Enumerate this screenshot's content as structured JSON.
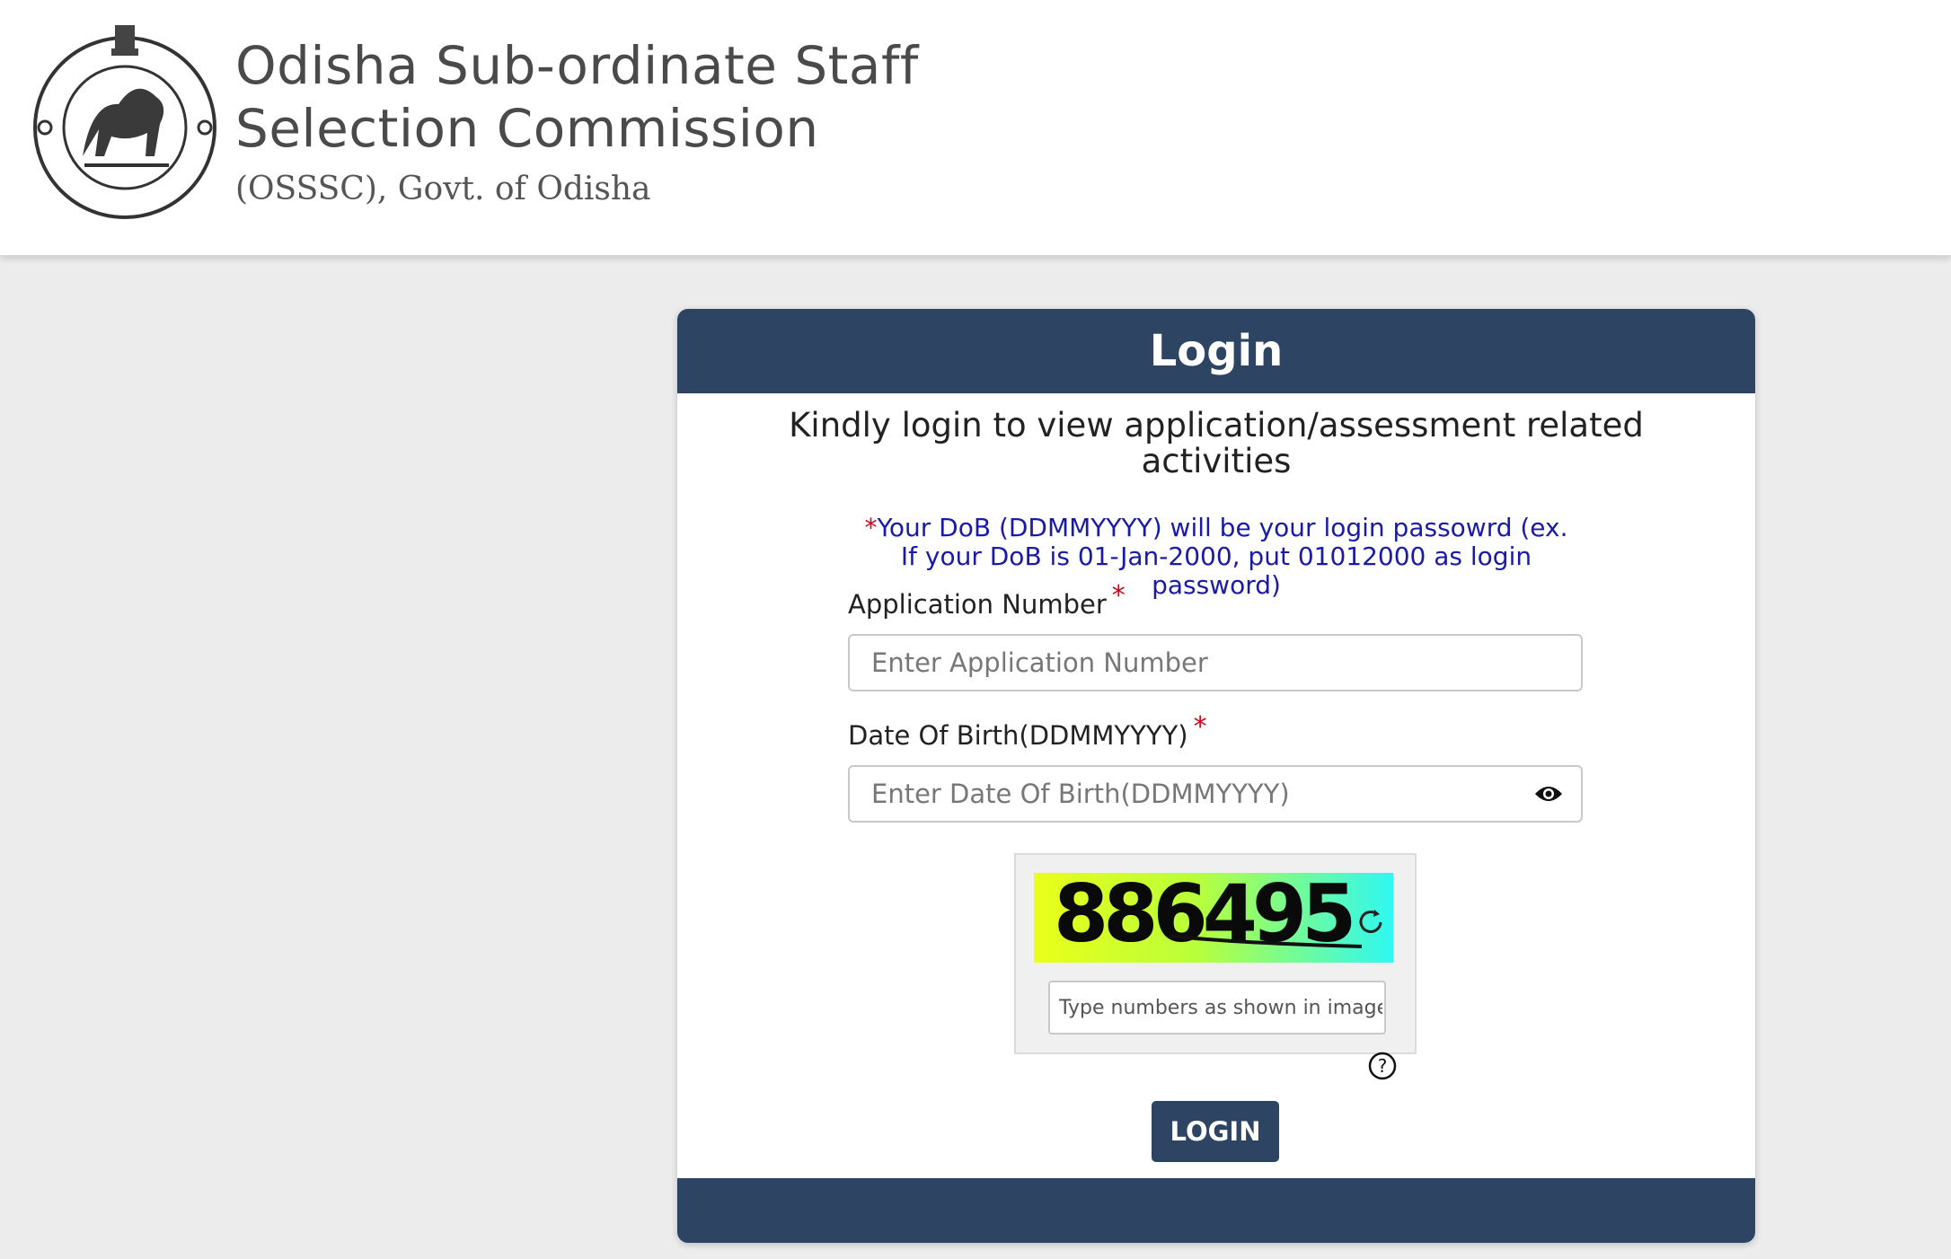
{
  "header": {
    "title_line1": "Odisha Sub-ordinate Staff",
    "title_line2": "Selection Commission",
    "subtitle": "(OSSSC), Govt. of Odisha",
    "emblem_icon": "odisha-state-emblem-icon"
  },
  "login_card": {
    "title": "Login",
    "intro": "Kindly login to view application/assessment related activities",
    "note_star": "*",
    "note": "Your DoB (DDMMYYYY) will be your login passowrd (ex. If your DoB is 01-Jan-2000, put 01012000 as login password)",
    "application_number": {
      "label": "Application Number",
      "required_mark": "*",
      "placeholder": "Enter Application Number",
      "value": ""
    },
    "dob": {
      "label": "Date Of Birth(DDMMYYYY)",
      "required_mark": "*",
      "placeholder": "Enter Date Of Birth(DDMMYYYY)",
      "value": "",
      "toggle_icon": "eye-icon"
    },
    "captcha": {
      "code": "886495",
      "refresh_icon": "refresh-icon",
      "input_placeholder": "Type numbers as shown in image",
      "input_value": "",
      "help_icon": "help-question-icon"
    },
    "login_button": "LOGIN"
  },
  "colors": {
    "primary": "#2d4462",
    "note_text": "#1a1aaa",
    "required": "#d0021b",
    "page_background": "#ececec"
  }
}
